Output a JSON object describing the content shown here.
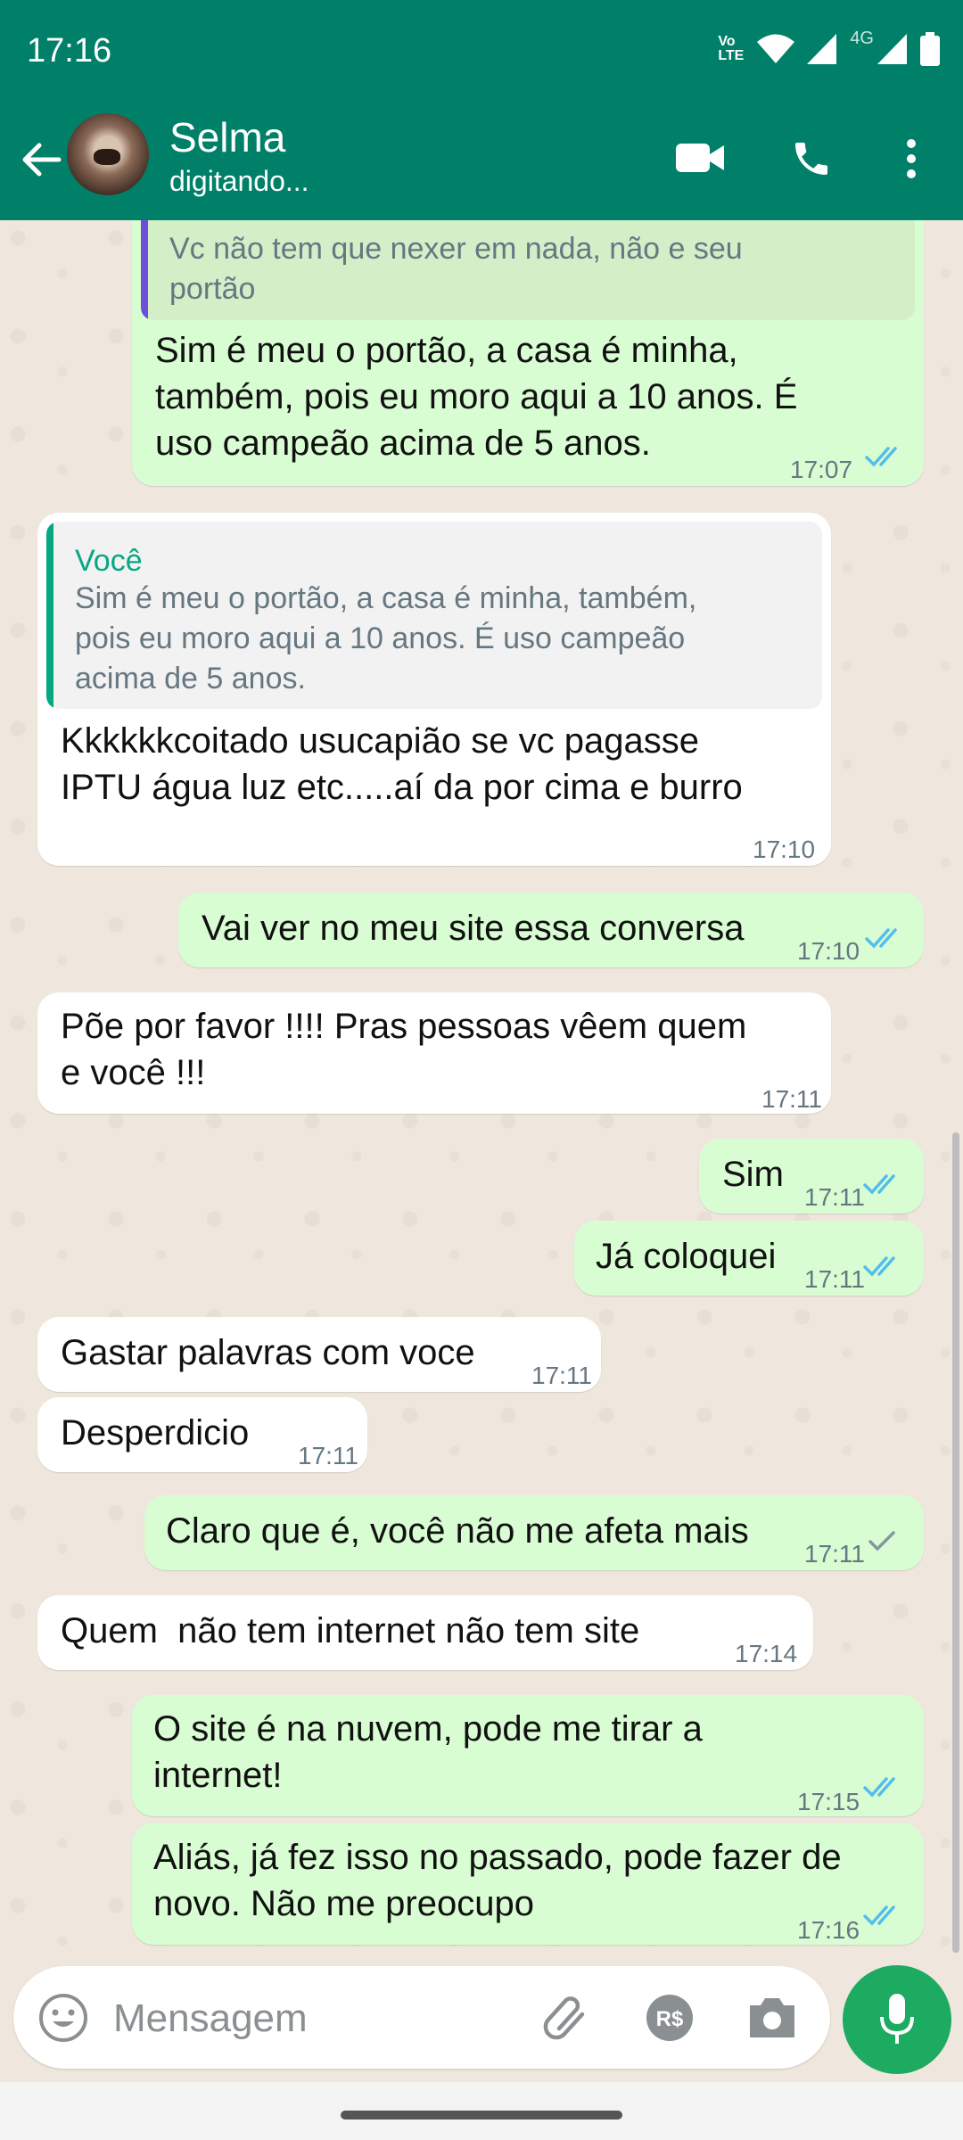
{
  "status_bar": {
    "time": "17:16",
    "volte": "Vo LTE",
    "network": "4G"
  },
  "header": {
    "contact_name": "Selma",
    "contact_status": "digitando..."
  },
  "messages": [
    {
      "direction": "out",
      "quote_text": "Vc não tem que nexer em nada, não e seu\nportão",
      "text": "Sim é meu o portão, a casa é minha,\ntambém, pois eu moro aqui a 10 anos. É\nuso campeão acima de 5 anos.",
      "time": "17:07",
      "status": "read"
    },
    {
      "direction": "in",
      "quote_author": "Você",
      "quote_text": "Sim é meu o portão, a casa é minha, também,\npois eu moro aqui a 10 anos. É uso campeão\nacima de 5 anos.",
      "text": "Kkkkkkcoitado usucapião se vc pagasse\nIPTU água luz etc.....aí da por cima e burro",
      "time": "17:10"
    },
    {
      "direction": "out",
      "text": "Vai ver no meu site essa conversa",
      "time": "17:10",
      "status": "read"
    },
    {
      "direction": "in",
      "text": "Põe por favor !!!! Pras pessoas vêem quem\ne você !!!",
      "time": "17:11"
    },
    {
      "direction": "out",
      "text": "Sim",
      "time": "17:11",
      "status": "read"
    },
    {
      "direction": "out",
      "text": "Já coloquei",
      "time": "17:11",
      "status": "read"
    },
    {
      "direction": "in",
      "text": "Gastar palavras com voce",
      "time": "17:11"
    },
    {
      "direction": "in",
      "text": "Desperdicio",
      "time": "17:11"
    },
    {
      "direction": "out",
      "text": "Claro que é, você não me afeta mais",
      "time": "17:11",
      "status": "delivered"
    },
    {
      "direction": "in",
      "text": "Quem  não tem internet não tem site",
      "time": "17:14"
    },
    {
      "direction": "out",
      "text": "O site é na nuvem, pode me tirar a\ninternet!",
      "time": "17:15",
      "status": "read"
    },
    {
      "direction": "out",
      "text": "Aliás, já fez isso no passado, pode fazer de\nnovo. Não me preocupo",
      "time": "17:16",
      "status": "read"
    }
  ],
  "composer": {
    "placeholder": "Mensagem"
  },
  "colors": {
    "header": "#008069",
    "outgoing_bubble": "#d9fdd3",
    "incoming_bubble": "#ffffff",
    "read_tick": "#53bdeb",
    "mic_button": "#1daa61"
  }
}
